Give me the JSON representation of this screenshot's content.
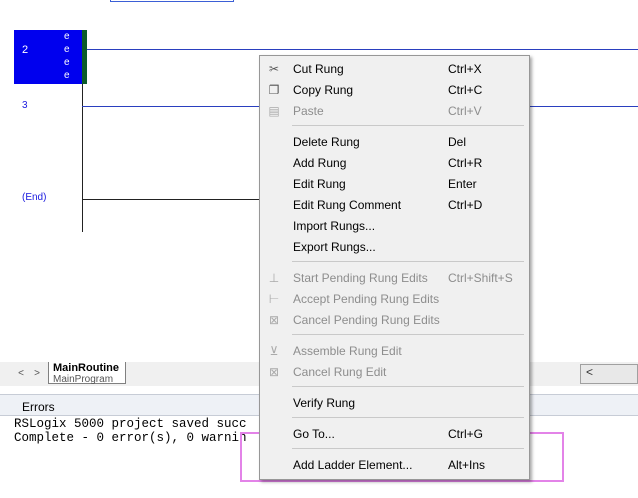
{
  "ladder": {
    "rungs": [
      {
        "number": "2",
        "marks": [
          "e",
          "e",
          "e",
          "e"
        ]
      },
      {
        "number": "3"
      },
      {
        "number": "(End)"
      }
    ]
  },
  "tabs": {
    "nav_prev": "<",
    "nav_next": ">",
    "active": {
      "title": "MainRoutine",
      "subtitle": "MainProgram"
    },
    "scroll_left": "<"
  },
  "errors": {
    "title": "Errors",
    "lines": [
      "RSLogix 5000 project saved succ",
      "Complete - 0 error(s), 0 warnin"
    ]
  },
  "context_menu": {
    "items": [
      {
        "label": "Cut Rung",
        "shortcut": "Ctrl+X",
        "icon": "scissors-icon",
        "enabled": true
      },
      {
        "label": "Copy Rung",
        "shortcut": "Ctrl+C",
        "icon": "copy-icon",
        "enabled": true
      },
      {
        "label": "Paste",
        "shortcut": "Ctrl+V",
        "icon": "paste-icon",
        "enabled": false
      },
      {
        "label": "Delete Rung",
        "shortcut": "Del",
        "enabled": true
      },
      {
        "label": "Add Rung",
        "shortcut": "Ctrl+R",
        "enabled": true
      },
      {
        "label": "Edit Rung",
        "shortcut": "Enter",
        "enabled": true
      },
      {
        "label": "Edit Rung Comment",
        "shortcut": "Ctrl+D",
        "enabled": true
      },
      {
        "label": "Import Rungs...",
        "shortcut": "",
        "enabled": true
      },
      {
        "label": "Export Rungs...",
        "shortcut": "",
        "enabled": true
      },
      {
        "label": "Start Pending Rung Edits",
        "shortcut": "Ctrl+Shift+S",
        "icon": "start-edits-icon",
        "enabled": false
      },
      {
        "label": "Accept Pending Rung Edits",
        "shortcut": "",
        "icon": "accept-edits-icon",
        "enabled": false
      },
      {
        "label": "Cancel Pending Rung Edits",
        "shortcut": "",
        "icon": "cancel-edits-icon",
        "enabled": false
      },
      {
        "label": "Assemble Rung Edit",
        "shortcut": "",
        "icon": "assemble-edit-icon",
        "enabled": false
      },
      {
        "label": "Cancel Rung Edit",
        "shortcut": "",
        "icon": "cancel-rung-edit-icon",
        "enabled": false
      },
      {
        "label": "Verify Rung",
        "shortcut": "",
        "enabled": true
      },
      {
        "label": "Go To...",
        "shortcut": "Ctrl+G",
        "enabled": true
      },
      {
        "label": "Add Ladder Element...",
        "shortcut": "Alt+Ins",
        "enabled": true
      }
    ]
  },
  "colors": {
    "selection": "#0000ee",
    "rung_number": "#1a1adf",
    "highlight_box": "#e383e8"
  }
}
